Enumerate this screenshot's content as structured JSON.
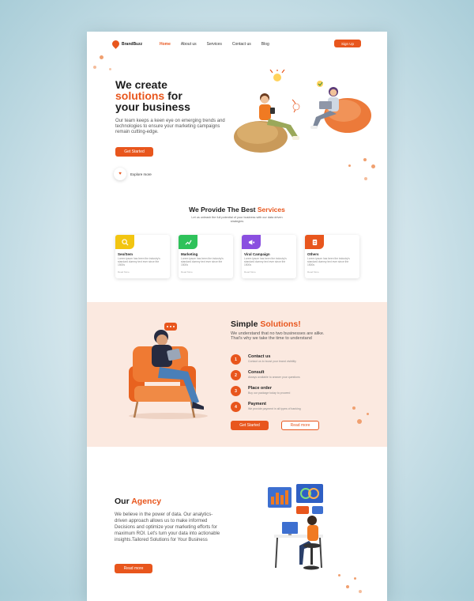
{
  "nav": {
    "logo": "BrandBuzz",
    "links": [
      "Home",
      "About us",
      "Services",
      "Contact us",
      "Blog"
    ],
    "signup": "Sign Up"
  },
  "hero": {
    "title_1": "We create",
    "title_accent": "solutions",
    "title_2": "for",
    "title_3": "your business",
    "description": "Our team keeps a keen eye on emerging trends and technologies to ensure your marketing campaigns remain cutting-edge.",
    "cta": "Get Started",
    "explore": "Explore more"
  },
  "services": {
    "title": "We Provide The Best",
    "title_accent": "Services",
    "subtitle": "Let us unleash the full potential of your business with our data driven strategies",
    "cards": [
      {
        "title": "Seo/Sem",
        "text": "Lorem ipsum has been the industry's standard dummy text ever since the 1500s",
        "link": "Read More",
        "color": "#f2c511",
        "icon": "search-icon"
      },
      {
        "title": "Marketing",
        "text": "Lorem ipsum has been the industry's standard dummy text ever since the 1500s",
        "link": "Read More",
        "color": "#2ec25a",
        "icon": "chart-icon"
      },
      {
        "title": "Viral Campaign",
        "text": "Lorem ipsum has been the industry's standard dummy text ever since the 1500s",
        "link": "Read More",
        "color": "#8a4fe0",
        "icon": "megaphone-icon"
      },
      {
        "title": "Others",
        "text": "Lorem ipsum has been the industry's standard dummy text ever since the 1500s",
        "link": "Read More",
        "color": "#e8561d",
        "icon": "document-icon"
      }
    ]
  },
  "solutions": {
    "title": "Simple",
    "title_accent": "Solutions!",
    "description": "We understand that no two businesses are alike. That's why we take the time to understand",
    "steps": [
      {
        "num": "1",
        "title": "Contact us",
        "text": "Contact us to boost your brand visibility"
      },
      {
        "num": "2",
        "title": "Consult",
        "text": "Always available to answer your questions"
      },
      {
        "num": "3",
        "title": "Place order",
        "text": "Buy our package today to proceed"
      },
      {
        "num": "4",
        "title": "Payment",
        "text": "We provide payment in all types of banking"
      }
    ],
    "cta": "Get Started",
    "read_more": "Read more"
  },
  "agency": {
    "title": "Our",
    "title_accent": "Agency",
    "description": "We believe in the power of data. Our analytics-driven approach allows us to make informed Decisions and optimize your marketing efforts for maximum ROI. Let's turn your data into actionable insights.Tailored Solutions for Your Business",
    "cta": "Read more"
  },
  "colors": {
    "accent": "#e8561d",
    "band": "#fbe9e0"
  }
}
